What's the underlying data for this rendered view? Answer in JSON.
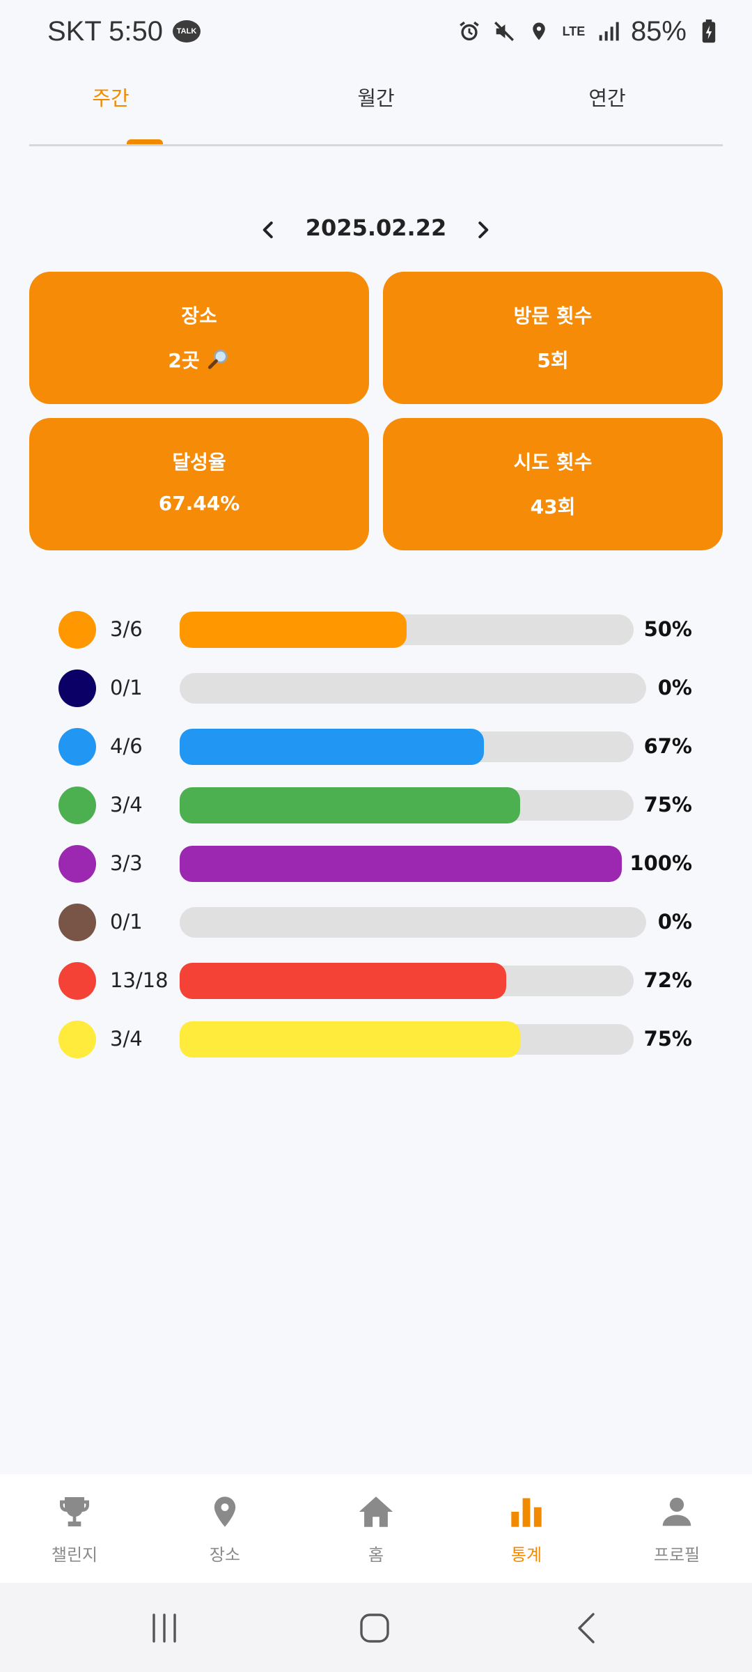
{
  "status_bar": {
    "carrier_time": "SKT 5:50",
    "talk_badge": "TALK",
    "network": "LTE",
    "battery": "85%"
  },
  "tabs": [
    {
      "label": "주간",
      "active": true
    },
    {
      "label": "월간",
      "active": false
    },
    {
      "label": "연간",
      "active": false
    }
  ],
  "date_nav": {
    "date": "2025.02.22"
  },
  "cards": {
    "places": {
      "title": "장소",
      "value": "2곳",
      "icon": "magnifier-icon"
    },
    "visits": {
      "title": "방문 횟수",
      "value": "5회"
    },
    "achievement": {
      "title": "달성율",
      "value": "67.44%"
    },
    "attempts": {
      "title": "시도 횟수",
      "value": "43회"
    }
  },
  "progress_rows": [
    {
      "ratio": "3/6",
      "percent_label": "50%",
      "progress": 0.5,
      "color": "#ff9800"
    },
    {
      "ratio": "0/1",
      "percent_label": "0%",
      "progress": 0.0,
      "color": "#0a0066"
    },
    {
      "ratio": "4/6",
      "percent_label": "67%",
      "progress": 0.67,
      "color": "#2196f3"
    },
    {
      "ratio": "3/4",
      "percent_label": "75%",
      "progress": 0.75,
      "color": "#4caf50"
    },
    {
      "ratio": "3/3",
      "percent_label": "100%",
      "progress": 1.0,
      "color": "#9c27b0"
    },
    {
      "ratio": "0/1",
      "percent_label": "0%",
      "progress": 0.0,
      "color": "#795548"
    },
    {
      "ratio": "13/18",
      "percent_label": "72%",
      "progress": 0.72,
      "color": "#f44336"
    },
    {
      "ratio": "3/4",
      "percent_label": "75%",
      "progress": 0.75,
      "color": "#ffeb3b"
    }
  ],
  "bottom_nav": [
    {
      "label": "챌린지",
      "icon": "trophy-icon",
      "active": false
    },
    {
      "label": "장소",
      "icon": "location-pin-icon",
      "active": false
    },
    {
      "label": "홈",
      "icon": "home-icon",
      "active": false
    },
    {
      "label": "통계",
      "icon": "bar-chart-icon",
      "active": true
    },
    {
      "label": "프로필",
      "icon": "person-icon",
      "active": false
    }
  ],
  "colors": {
    "accent": "#f28a00",
    "card": "#f68b07",
    "inactive": "#8a8a8a"
  }
}
